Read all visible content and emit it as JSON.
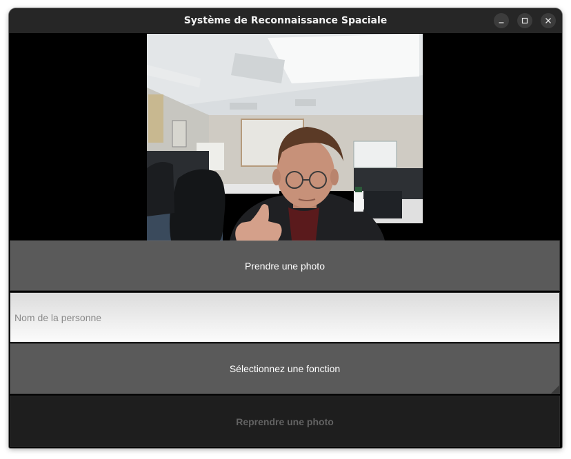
{
  "window": {
    "title": "Système de Reconnaissance Spaciale",
    "controls": [
      "minimize-icon",
      "maximize-icon",
      "close-icon"
    ]
  },
  "camera": {
    "icon": "camera-feed"
  },
  "actions": {
    "take_photo_label": "Prendre une photo",
    "name_placeholder": "Nom de la personne",
    "name_value": "",
    "function_select_label": "Sélectionnez une fonction",
    "retake_photo_label": "Reprendre une photo"
  },
  "colors": {
    "titlebar": "#262626",
    "button": "#5a5a5a",
    "disabled_button": "#1e1e1e",
    "disabled_text": "#626262"
  }
}
